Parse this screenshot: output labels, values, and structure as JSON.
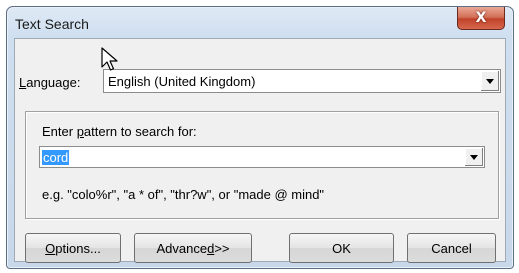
{
  "window": {
    "title": "Text Search",
    "close_glyph": "X"
  },
  "language": {
    "label_prefix": "",
    "label_mnemonic": "L",
    "label_rest": "anguage:",
    "value": "English (United Kingdom)"
  },
  "pattern": {
    "label_before": "Enter ",
    "label_mnemonic": "p",
    "label_after": "attern to search for:",
    "value": "cord",
    "example": "e.g. \"colo%r\", \"a * of\", \"thr?w\", or \"made @ mind\""
  },
  "buttons": {
    "options": {
      "mnemonic": "O",
      "rest": "ptions..."
    },
    "advanced": {
      "before": "Advance",
      "mnemonic": "d",
      "after": " >>"
    },
    "ok": "OK",
    "cancel": "Cancel"
  },
  "icons": {
    "close": "close-icon",
    "dropdown": "chevron-down-icon",
    "cursor": "mouse-pointer-icon"
  },
  "colors": {
    "selection": "#3399ff",
    "close_button": "#c0432a"
  }
}
